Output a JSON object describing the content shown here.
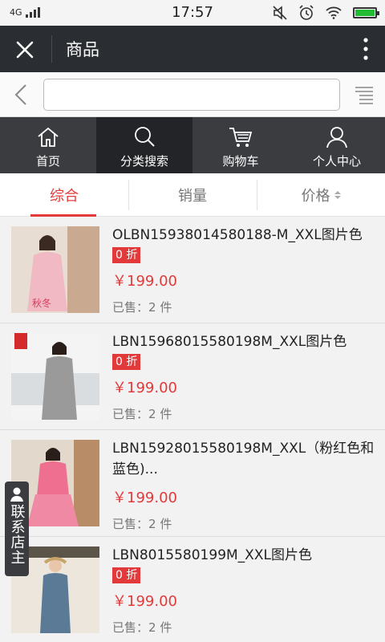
{
  "status_bar": {
    "network": "4G",
    "time": "17:57"
  },
  "title_bar": {
    "title": "商品"
  },
  "search": {
    "placeholder": "",
    "value": ""
  },
  "nav": [
    {
      "label": "首页",
      "icon": "home-icon",
      "active": false
    },
    {
      "label": "分类搜索",
      "icon": "search-icon",
      "active": true
    },
    {
      "label": "购物车",
      "icon": "cart-icon",
      "active": false
    },
    {
      "label": "个人中心",
      "icon": "user-icon",
      "active": false
    }
  ],
  "sort_tabs": [
    {
      "label": "综合",
      "active": true
    },
    {
      "label": "销量",
      "active": false
    },
    {
      "label": "价格",
      "active": false
    }
  ],
  "products": [
    {
      "name": "OLBN15938014580188-M_XXL图片色",
      "discount": "0 折",
      "price": "￥199.00",
      "sold_label": "已售：",
      "sold_count": "2 件",
      "thumb_text": "秋冬",
      "color": "#f1b9c4"
    },
    {
      "name": "LBN15968015580198M_XXL图片色",
      "discount": "0 折",
      "price": "￥199.00",
      "sold_label": "已售：",
      "sold_count": "2 件",
      "thumb_text": "",
      "color": "#9a9a9a"
    },
    {
      "name": "LBN15928015580198M_XXL（粉红色和蓝色)...",
      "discount": "",
      "price": "￥199.00",
      "sold_label": "已售：",
      "sold_count": "2 件",
      "thumb_text": "",
      "color": "#ee6f8f"
    },
    {
      "name": "LBN8015580199M_XXL图片色",
      "discount": "0 折",
      "price": "￥199.00",
      "sold_label": "已售：",
      "sold_count": "2 件",
      "thumb_text": "",
      "color": "#5a7a96"
    }
  ],
  "contact": {
    "label": "联系店主"
  },
  "colors": {
    "accent": "#e23a3a",
    "dark_bar": "#2a2d31",
    "nav_bg": "#3a3c40"
  }
}
